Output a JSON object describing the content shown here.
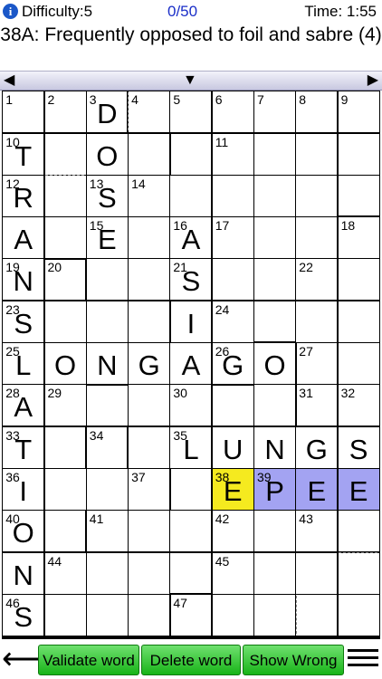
{
  "header": {
    "info_icon": "i",
    "difficulty": "Difficulty:5",
    "progress": "0/50",
    "time": "Time: 1:55"
  },
  "clue": {
    "text": "38A: Frequently opposed to foil and sabre (4)"
  },
  "nav": {
    "prev": "◀",
    "down": "▼",
    "next": "▶"
  },
  "colors": {
    "current_cell": "#f5ea1f",
    "word_highlight": "#a3a3f2",
    "button_green": "#33c433",
    "progress_blue": "#1a2ec8"
  },
  "grid": {
    "cols": 9,
    "rows": 13,
    "numbers": [
      [
        "1",
        "2",
        "3",
        "4",
        "5",
        "6",
        "7",
        "8",
        "9"
      ],
      [
        "10",
        "",
        "",
        "",
        "",
        "11",
        "",
        "",
        ""
      ],
      [
        "12",
        "",
        "13",
        "14",
        "",
        "",
        "",
        "",
        ""
      ],
      [
        "",
        "",
        "15",
        "",
        "16",
        "17",
        "",
        "",
        "18"
      ],
      [
        "19",
        "20",
        "",
        "",
        "21",
        "",
        "",
        "22",
        ""
      ],
      [
        "23",
        "",
        "",
        "",
        "",
        "24",
        "",
        "",
        ""
      ],
      [
        "25",
        "",
        "",
        "",
        "",
        "26",
        "",
        "27",
        ""
      ],
      [
        "28",
        "29",
        "",
        "",
        "30",
        "",
        "",
        "31",
        "32"
      ],
      [
        "33",
        "",
        "34",
        "",
        "35",
        "",
        "",
        "",
        ""
      ],
      [
        "36",
        "",
        "",
        "37",
        "",
        "38",
        "39",
        "",
        ""
      ],
      [
        "40",
        "",
        "41",
        "",
        "",
        "42",
        "",
        "43",
        ""
      ],
      [
        "",
        "44",
        "",
        "",
        "",
        "45",
        "",
        "",
        ""
      ],
      [
        "46",
        "",
        "",
        "",
        "47",
        "",
        "",
        "",
        ""
      ]
    ],
    "letters": [
      [
        "",
        "",
        "D",
        "",
        "",
        "",
        "",
        "",
        ""
      ],
      [
        "T",
        "",
        "O",
        "",
        "",
        "",
        "",
        "",
        ""
      ],
      [
        "R",
        "",
        "S",
        "",
        "",
        "",
        "",
        "",
        ""
      ],
      [
        "A",
        "",
        "E",
        "",
        "A",
        "",
        "",
        "",
        ""
      ],
      [
        "N",
        "",
        "",
        "",
        "S",
        "",
        "",
        "",
        ""
      ],
      [
        "S",
        "",
        "",
        "",
        "I",
        "",
        "",
        "",
        ""
      ],
      [
        "L",
        "O",
        "N",
        "G",
        "A",
        "G",
        "O",
        "",
        ""
      ],
      [
        "A",
        "",
        "",
        "",
        "",
        "",
        "",
        "",
        ""
      ],
      [
        "T",
        "",
        "",
        "",
        "L",
        "U",
        "N",
        "G",
        "S"
      ],
      [
        "I",
        "",
        "",
        "",
        "",
        "E",
        "P",
        "E",
        "E"
      ],
      [
        "O",
        "",
        "",
        "",
        "",
        "",
        "",
        "",
        ""
      ],
      [
        "N",
        "",
        "",
        "",
        "",
        "",
        "",
        "",
        ""
      ],
      [
        "S",
        "",
        "",
        "",
        "",
        "",
        "",
        "",
        ""
      ]
    ]
  },
  "toolbar": {
    "back": "⟵",
    "validate": "Validate word",
    "delete": "Delete word",
    "show_wrong": "Show Wrong",
    "menu_icon": "hamburger-menu-icon"
  }
}
